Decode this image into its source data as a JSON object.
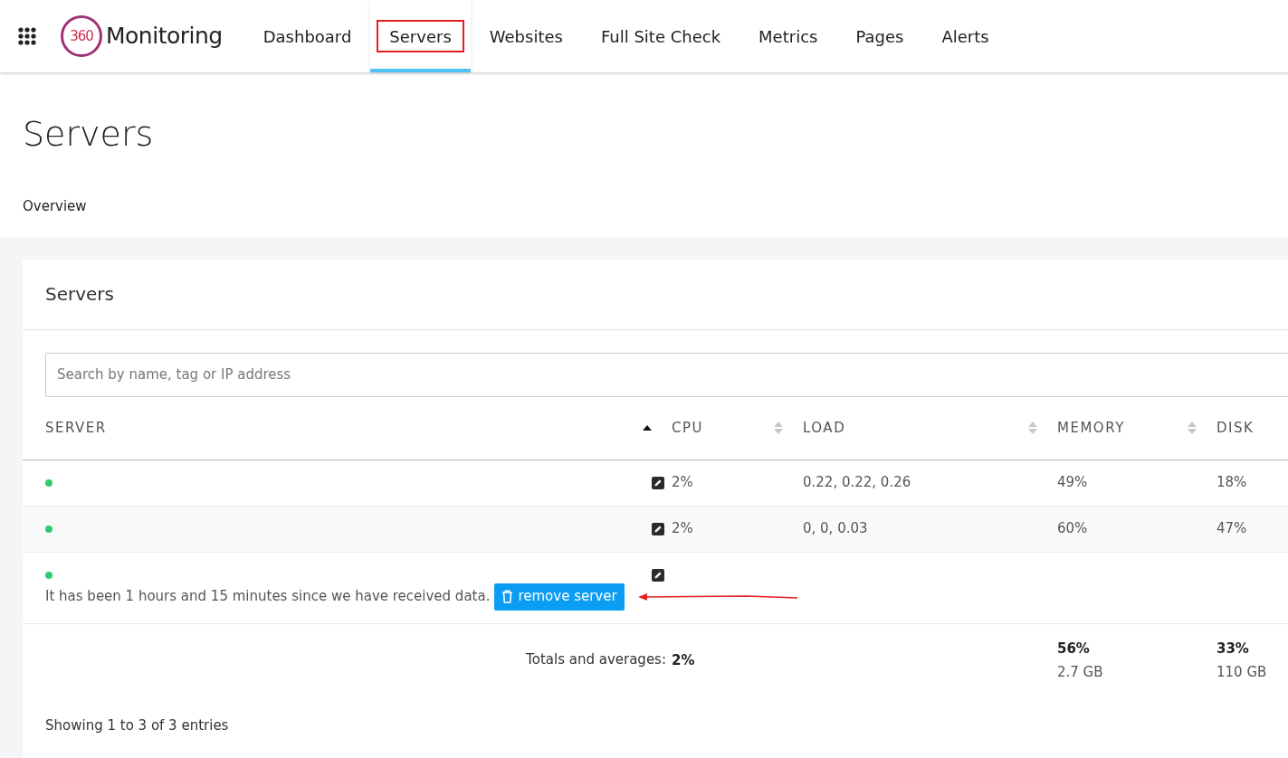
{
  "nav": {
    "logo_mark": "360",
    "logo_text": "Monitoring",
    "tabs": [
      {
        "label": "Dashboard",
        "selected": false,
        "highlighted": false
      },
      {
        "label": "Servers",
        "selected": true,
        "highlighted": true
      },
      {
        "label": "Websites",
        "selected": false,
        "highlighted": false
      },
      {
        "label": "Full Site Check",
        "selected": false,
        "highlighted": false
      },
      {
        "label": "Metrics",
        "selected": false,
        "highlighted": false
      },
      {
        "label": "Pages",
        "selected": false,
        "highlighted": false
      },
      {
        "label": "Alerts",
        "selected": false,
        "highlighted": false
      }
    ]
  },
  "page": {
    "title": "Servers",
    "breadcrumb": "Overview"
  },
  "card": {
    "title": "Servers",
    "search": {
      "placeholder": "Search by name, tag or IP address"
    },
    "columns": [
      {
        "label": "SERVER",
        "sorted": true
      },
      {
        "label": "CPU",
        "sorted": false
      },
      {
        "label": "LOAD",
        "sorted": false
      },
      {
        "label": "MEMORY",
        "sorted": false
      },
      {
        "label": "DISK"
      }
    ],
    "rows": [
      {
        "color": "#2ecc71",
        "cpu": "2%",
        "load": "0.22, 0.22, 0.26",
        "memory": "49%",
        "disk": "18%"
      },
      {
        "color": "#2ecc71",
        "cpu": "2%",
        "load": "0, 0, 0.03",
        "memory": "60%",
        "disk": "47%"
      },
      {
        "color": "#2ecc71",
        "message": "It has been 1 hours and 15 minutes since we have received data.",
        "action": "remove server",
        "annotated": true
      }
    ],
    "totals": {
      "label": "Totals and averages:",
      "cpu": "2%",
      "memory": "56%",
      "memory_size": "2.7 GB",
      "disk": "33%",
      "disk_size": "110 GB"
    },
    "footer": "Showing 1 to 3 of 3 entries"
  }
}
